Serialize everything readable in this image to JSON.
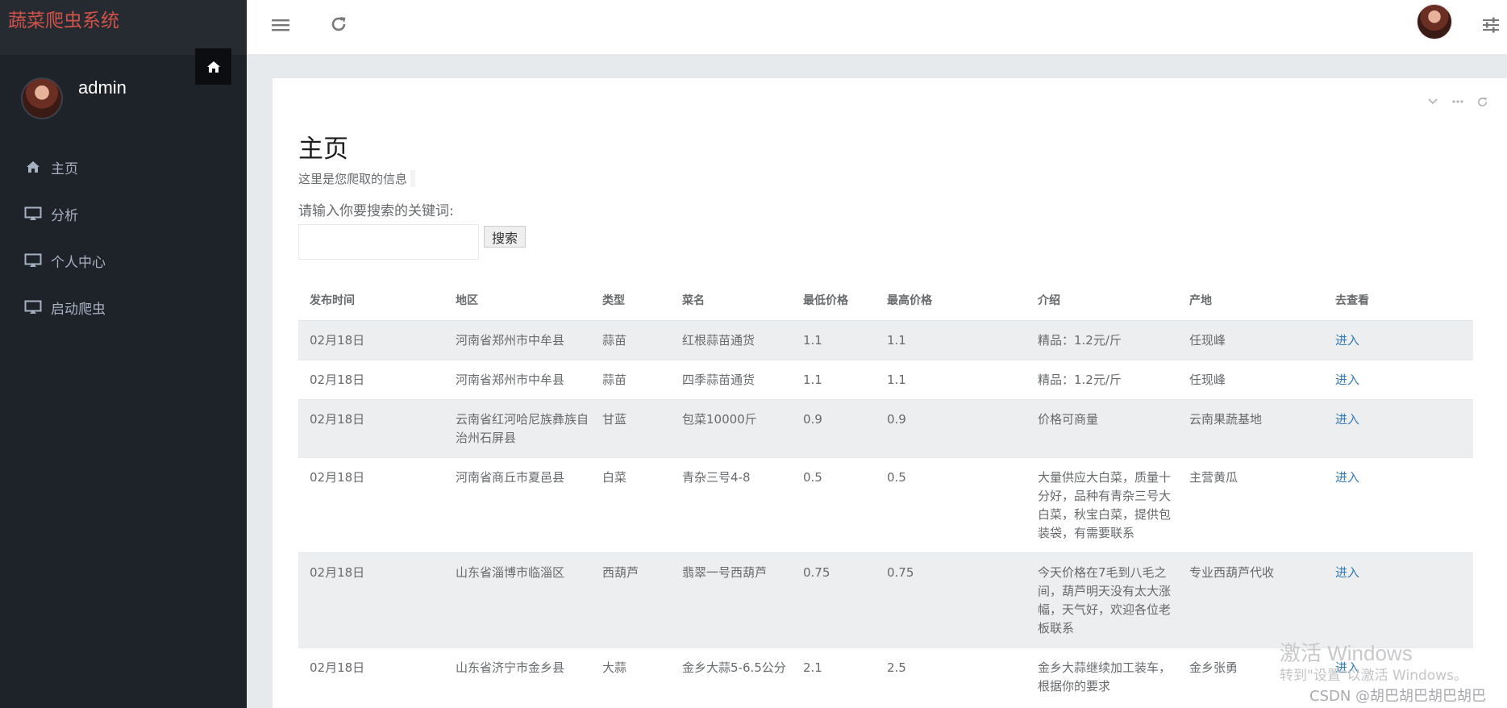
{
  "app": {
    "brand": "蔬菜爬虫系统"
  },
  "sidebar": {
    "username": "admin",
    "items": [
      {
        "label": "主页",
        "icon": "home-icon"
      },
      {
        "label": "分析",
        "icon": "monitor-icon"
      },
      {
        "label": "个人中心",
        "icon": "monitor-icon"
      },
      {
        "label": "启动爬虫",
        "icon": "monitor-icon"
      }
    ]
  },
  "main": {
    "title": "主页",
    "description": "这里是您爬取的信息",
    "search_label": "请输入你要搜索的关键词:",
    "search_value": "",
    "search_button": "搜索"
  },
  "table": {
    "headers": [
      "发布时间",
      "地区",
      "类型",
      "菜名",
      "最低价格",
      "最高价格",
      "介绍",
      "产地",
      "去查看"
    ],
    "rows": [
      [
        "02月18日",
        "河南省郑州市中牟县",
        "蒜苗",
        "红根蒜苗通货",
        "1.1",
        "1.1",
        "精品：1.2元/斤",
        "任现峰",
        "进入"
      ],
      [
        "02月18日",
        "河南省郑州市中牟县",
        "蒜苗",
        "四季蒜苗通货",
        "1.1",
        "1.1",
        "精品：1.2元/斤",
        "任现峰",
        "进入"
      ],
      [
        "02月18日",
        "云南省红河哈尼族彝族自治州石屏县",
        "甘蓝",
        "包菜10000斤",
        "0.9",
        "0.9",
        "价格可商量",
        "云南果蔬基地",
        "进入"
      ],
      [
        "02月18日",
        "河南省商丘市夏邑县",
        "白菜",
        "青杂三号4-8",
        "0.5",
        "0.5",
        "大量供应大白菜，质量十分好，品种有青杂三号大白菜，秋宝白菜，提供包装袋，有需要联系",
        "主营黄瓜",
        "进入"
      ],
      [
        "02月18日",
        "山东省淄博市临淄区",
        "西葫芦",
        "翡翠一号西葫芦",
        "0.75",
        "0.75",
        "今天价格在7毛到八毛之间，葫芦明天没有太大涨幅，天气好，欢迎各位老板联系",
        "专业西葫芦代收",
        "进入"
      ],
      [
        "02月18日",
        "山东省济宁市金乡县",
        "大蒜",
        "金乡大蒜5-6.5公分",
        "2.1",
        "2.5",
        "金乡大蒜继续加工装车，根据你的要求",
        "金乡张勇",
        "进入"
      ]
    ]
  },
  "watermark": {
    "title": "激活 Windows",
    "subtitle": "转到\"设置\"以激活 Windows。",
    "csdn": "CSDN @胡巴胡巴胡巴胡巴"
  },
  "colors": {
    "brand": "#d0534a",
    "sidebar_bg": "#1e2229",
    "link": "#337ab7"
  }
}
